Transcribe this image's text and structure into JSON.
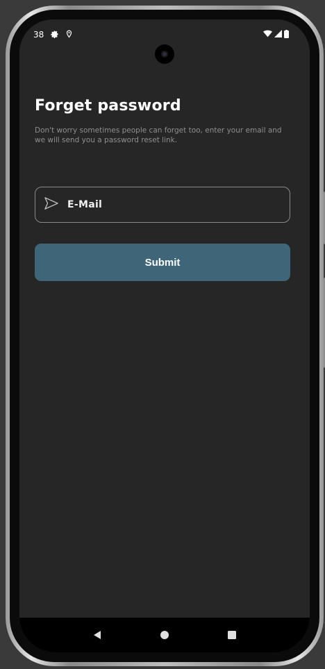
{
  "status_bar": {
    "time": "38",
    "icons": [
      "settings-icon",
      "location-icon",
      "wifi-icon",
      "signal-icon",
      "battery-icon"
    ]
  },
  "screen": {
    "title": "Forget password",
    "subtitle": "Don't worry sometimes people can forget too, enter your email and we will send you a password reset link.",
    "email_field": {
      "placeholder": "E-Mail",
      "icon": "send-icon"
    },
    "submit_label": "Submit"
  },
  "nav_bar": {
    "buttons": [
      "back-icon",
      "home-icon",
      "recents-icon"
    ]
  },
  "colors": {
    "background": "#262626",
    "button": "#3f6678",
    "field_border": "#8a8a8a",
    "subtitle": "#8f8f8f"
  }
}
